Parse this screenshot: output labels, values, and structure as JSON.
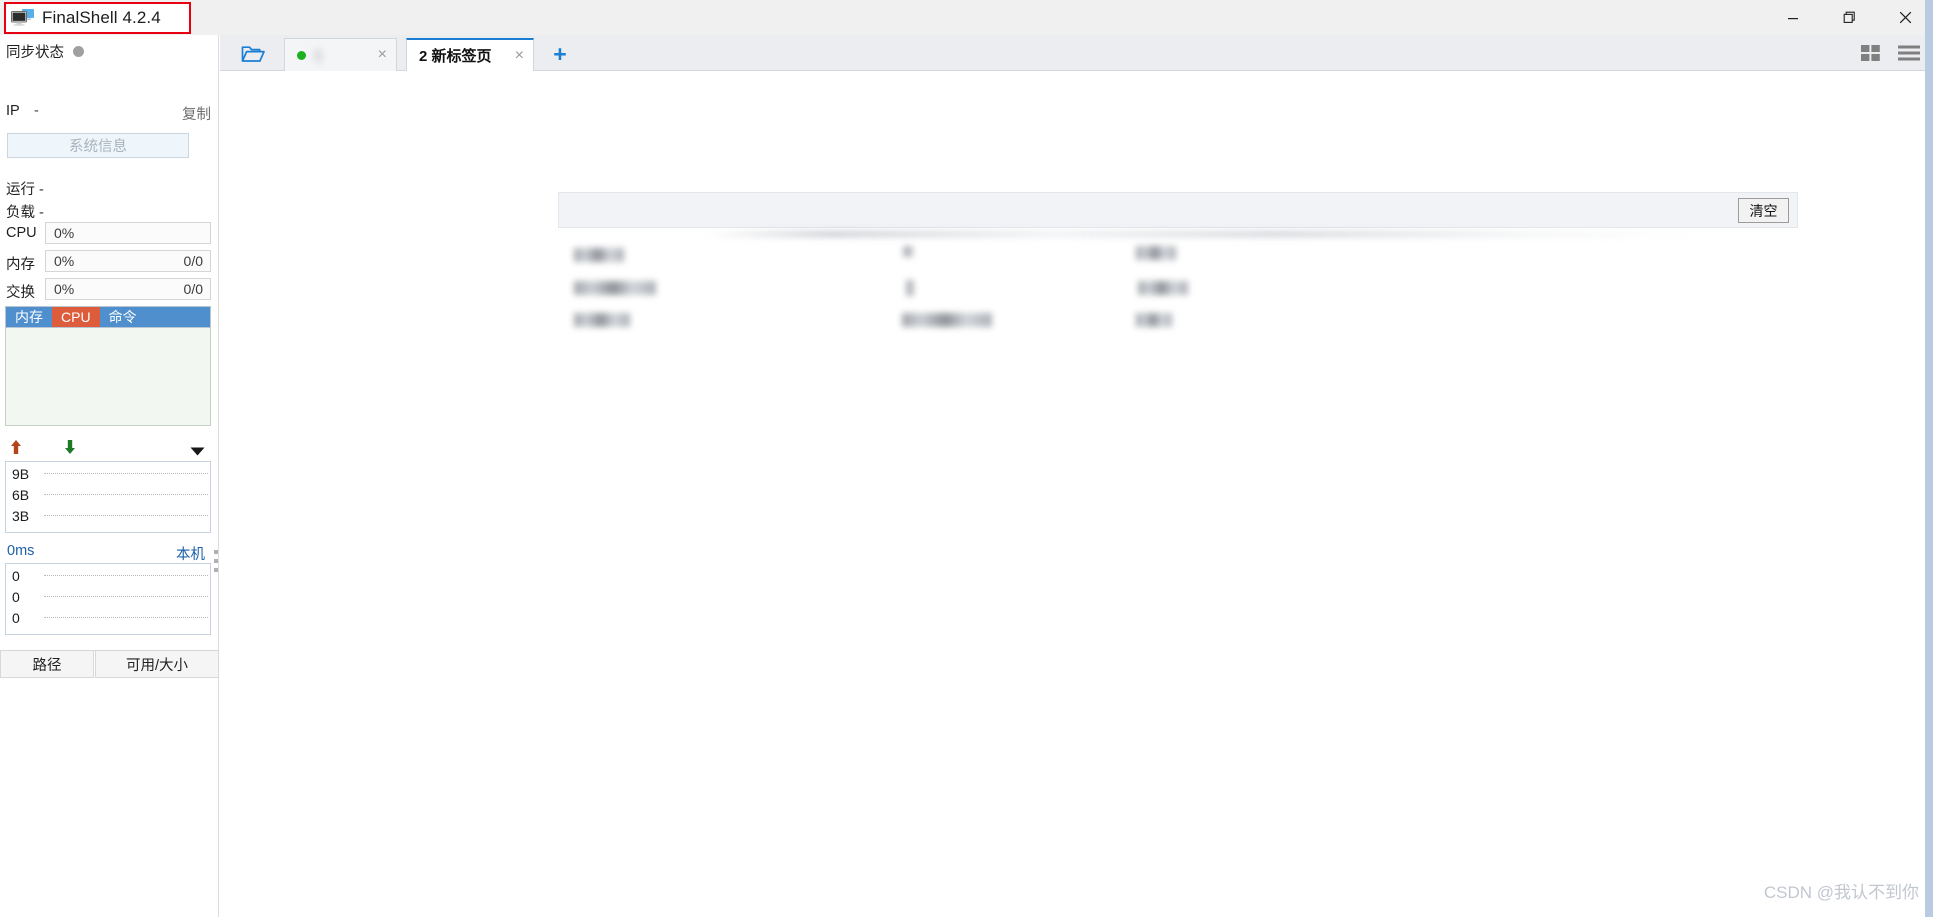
{
  "window": {
    "title": "FinalShell 4.2.4",
    "app_icon": "monitor-icon",
    "minimize_label": "minimize-icon",
    "maximize_label": "maximize-icon",
    "close_label": "close-icon",
    "highlight_color": "#e60012"
  },
  "tabstrip": {
    "folder_icon": "open-folder-icon",
    "new_tab_label": "+",
    "grid_icon": "grid-view-icon",
    "menu_icon": "hamburger-menu-icon",
    "tabs": [
      {
        "label": "1",
        "status": "connected",
        "close_label": "×",
        "active": false,
        "blurred": true
      },
      {
        "label": "2 新标签页",
        "close_label": "×",
        "active": true,
        "blurred": false
      }
    ]
  },
  "sidebar": {
    "sync": {
      "label": "同步状态",
      "status_color": "#a0a0a0"
    },
    "ip": {
      "key": "IP",
      "value": "-",
      "copy_label": "复制"
    },
    "system_info_button": "系统信息",
    "uptime": {
      "key": "运行",
      "value": "-"
    },
    "load": {
      "key": "负载",
      "value": "-"
    },
    "cpu": {
      "key": "CPU",
      "percent": "0%",
      "right": ""
    },
    "memory": {
      "key": "内存",
      "percent": "0%",
      "right": "0/0"
    },
    "swap": {
      "key": "交换",
      "percent": "0%",
      "right": "0/0"
    },
    "process_tabs": [
      {
        "label": "内存",
        "selected": false
      },
      {
        "label": "CPU",
        "selected": true
      },
      {
        "label": "命令",
        "selected": false
      }
    ],
    "process_tab_colors": {
      "bar": "#4f8fce",
      "selected": "#dd5c3c"
    },
    "network": {
      "upload_icon": "upload-arrow-icon",
      "download_icon": "download-arrow-icon",
      "expand_icon": "chevron-down-icon",
      "y_labels": [
        "9B",
        "6B",
        "3B"
      ]
    },
    "ping": {
      "latency": "0ms",
      "host": "本机",
      "y_labels": [
        "0",
        "0",
        "0"
      ]
    },
    "disk_header": {
      "path": "路径",
      "usage": "可用/大小"
    }
  },
  "content": {
    "panel_title": "",
    "clear_button": "清空",
    "rows": [
      {
        "cols": [
          "",
          "",
          ""
        ]
      },
      {
        "cols": [
          "",
          "",
          ""
        ]
      },
      {
        "cols": [
          "",
          "",
          ""
        ]
      }
    ]
  },
  "watermark": "CSDN @我认不到你"
}
